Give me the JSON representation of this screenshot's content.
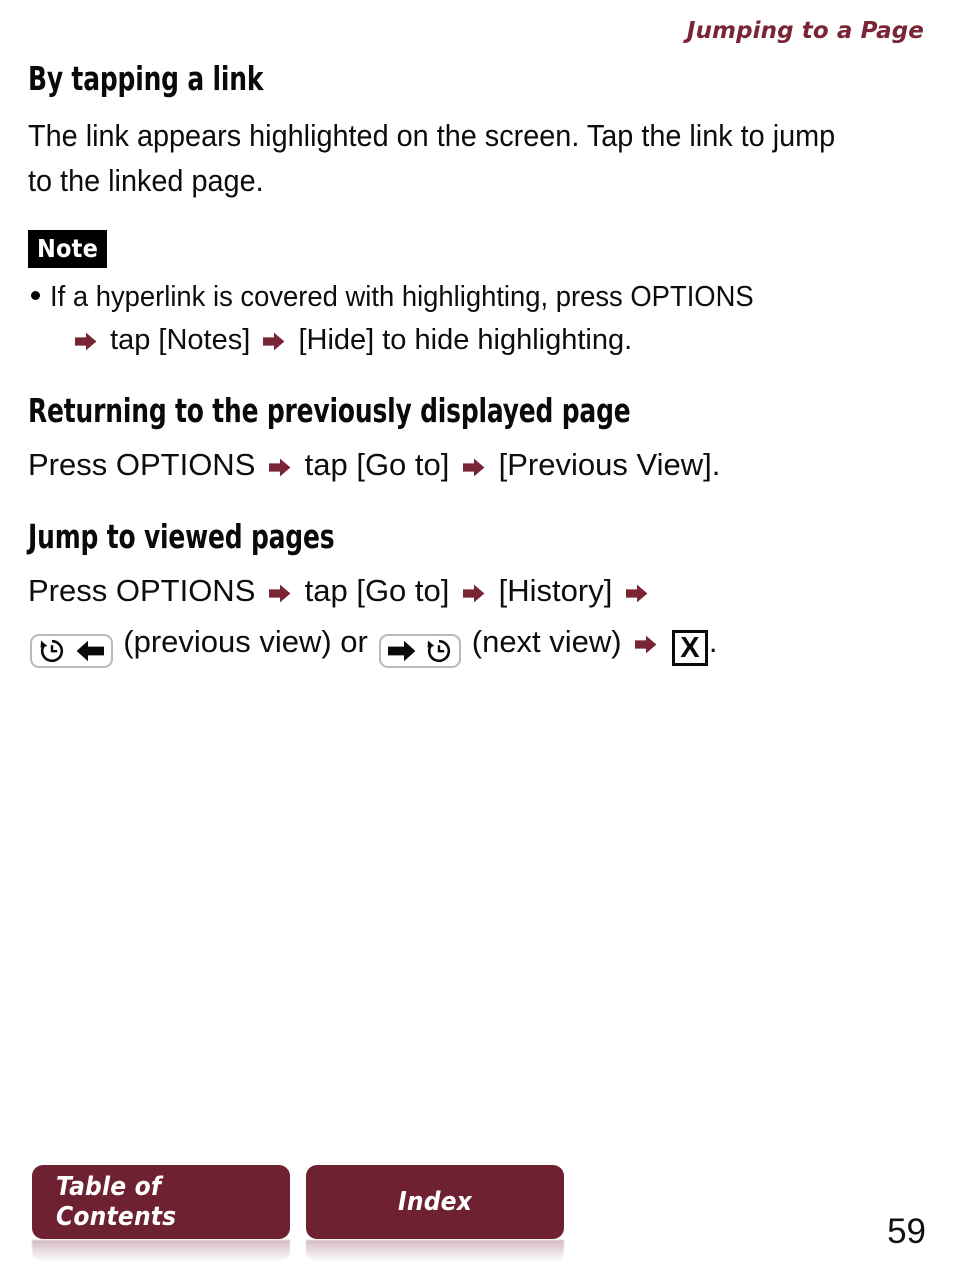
{
  "header": {
    "running_title": "Jumping to a Page",
    "accent_color": "#7a2535"
  },
  "sections": [
    {
      "heading": "By tapping a link",
      "paragraph": "The link appears highlighted on the screen. Tap the link to jump to the linked page."
    },
    {
      "heading": "Returning to the previously displayed page"
    },
    {
      "heading": "Jump to viewed pages"
    }
  ],
  "note": {
    "badge_label": "Note",
    "bullet_line_1": "If a hyperlink is covered with highlighting, press OPTIONS",
    "bullet_line_2_part_1": "tap [Notes]",
    "bullet_line_2_part_2": "[Hide] to hide highlighting."
  },
  "returning": {
    "part_1": "Press OPTIONS",
    "part_2": "tap [Go to]",
    "part_3": "[Previous View]."
  },
  "jump_to_viewed": {
    "line1_part_1": "Press OPTIONS",
    "line1_part_2": "tap [Go to]",
    "line1_part_3": "[History]",
    "line2_previous_label": "(previous view) or",
    "line2_next_label": "(next view)",
    "line2_trailing_period": ".",
    "icon_previous_view": "history-back-key-icon",
    "icon_next_view": "history-forward-key-icon",
    "icon_close": "x-key-icon",
    "x_key_label": "X"
  },
  "icons": {
    "arrow_right_red": "arrow-right-red-icon",
    "bullet": "bullet-dot-icon",
    "clock_back": "clock-counterclockwise-icon",
    "arrow_left_solid": "arrow-left-solid-icon",
    "arrow_right_solid": "arrow-right-solid-icon"
  },
  "footer": {
    "table_of_contents_label": "Table of Contents",
    "index_label": "Index",
    "button_color": "#6e2231",
    "page_number": "59"
  }
}
